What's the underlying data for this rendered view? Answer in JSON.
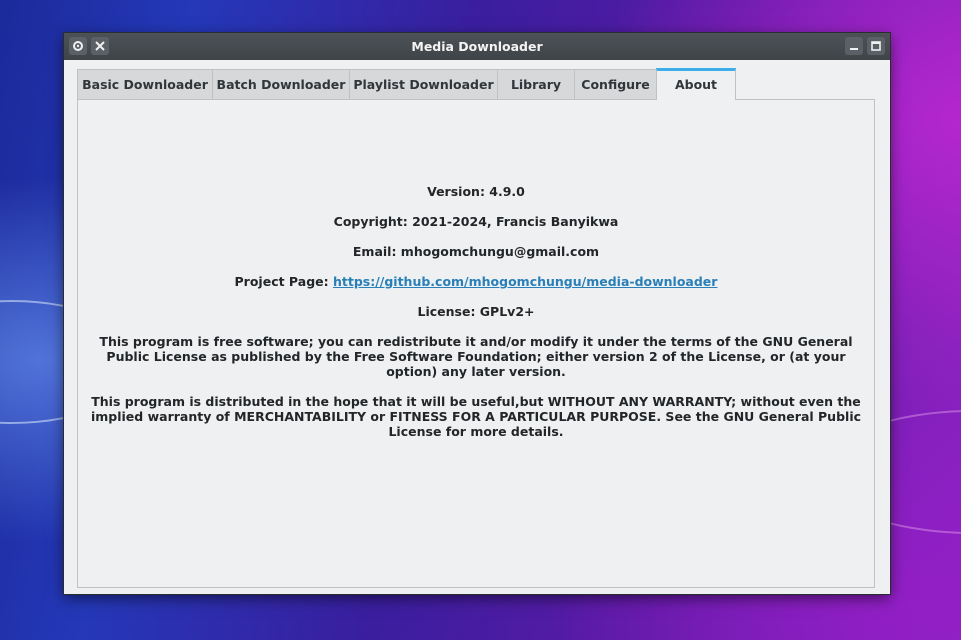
{
  "window": {
    "title": "Media Downloader"
  },
  "tabs": [
    {
      "label": "Basic Downloader",
      "active": false
    },
    {
      "label": "Batch Downloader",
      "active": false
    },
    {
      "label": "Playlist Downloader",
      "active": false
    },
    {
      "label": "Library",
      "active": false
    },
    {
      "label": "Configure",
      "active": false
    },
    {
      "label": "About",
      "active": true
    }
  ],
  "about": {
    "version": "Version: 4.9.0",
    "copyright": "Copyright: 2021-2024, Francis Banyikwa",
    "email": "Email: mhogomchungu@gmail.com",
    "project_label": "Project Page: ",
    "project_url": "https://github.com/mhogomchungu/media-downloader",
    "license": "License: GPLv2+",
    "paragraph1": "This program is free software; you can redistribute it and/or modify it under the terms of the GNU General Public License as published by the Free Software Foundation; either version 2 of the License, or (at your option) any later version.",
    "paragraph2": "This program is distributed in the hope that it will be useful,but WITHOUT ANY WARRANTY; without even the implied warranty of MERCHANTABILITY or FITNESS FOR A PARTICULAR PURPOSE. See the GNU General Public License for more details."
  },
  "colors": {
    "accent": "#3daee9",
    "link": "#2980b9",
    "titlebar": "#474c51"
  }
}
